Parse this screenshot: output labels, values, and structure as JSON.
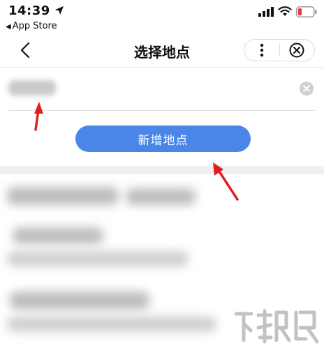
{
  "status_bar": {
    "time": "14:39",
    "back_app": "App Store"
  },
  "nav": {
    "title": "选择地点"
  },
  "actions": {
    "add_location_label": "新增地点"
  },
  "colors": {
    "primary_button": "#4a86e8",
    "annotation_arrow": "#e02020",
    "battery_low": "#e53935"
  },
  "icons": {
    "back": "chevron-left-icon",
    "more": "more-vertical-icon",
    "close": "circle-close-icon",
    "clear": "clear-icon",
    "location_arrow": "location-arrow-icon",
    "signal": "signal-icon",
    "wifi": "wifi-icon",
    "battery": "battery-icon"
  }
}
